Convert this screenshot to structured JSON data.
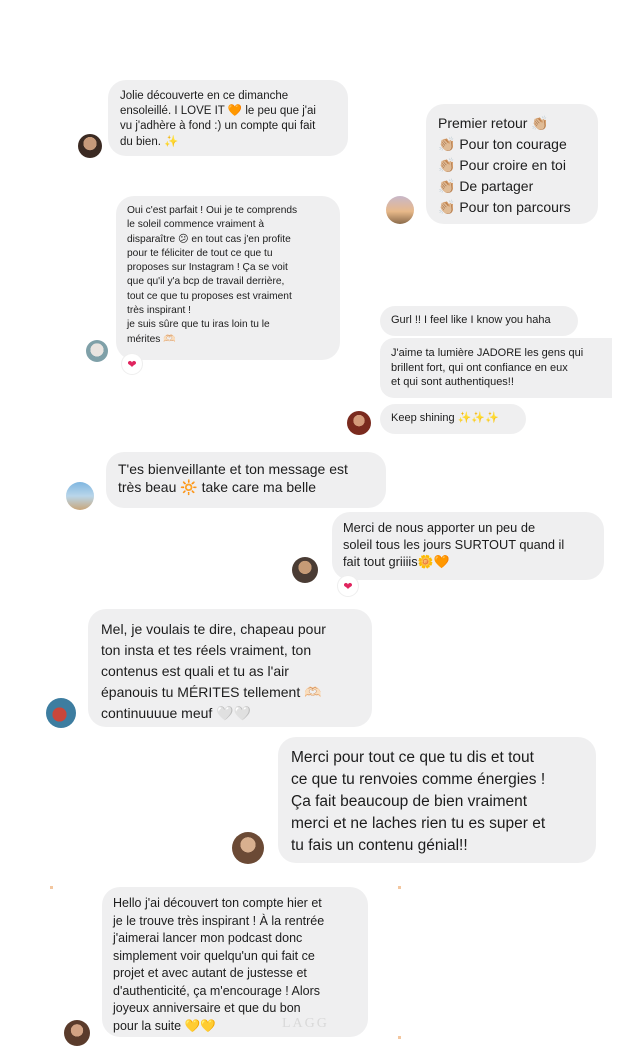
{
  "messages": [
    {
      "id": "m1",
      "lines": [
        "Jolie découverte en ce dimanche",
        "ensoleillé. I LOVE IT 🧡 le peu que j'ai",
        "vu j'adhère à fond :) un compte qui fait",
        "du bien. ✨"
      ]
    },
    {
      "id": "m2",
      "lines": [
        "Premier retour 👏🏼",
        "👏🏼 Pour ton courage",
        "👏🏼 Pour croire en toi",
        "👏🏼  De partager",
        "👏🏼 Pour ton parcours"
      ]
    },
    {
      "id": "m3",
      "lines": [
        "Oui c'est parfait ! Oui je te comprends",
        "le soleil commence vraiment à",
        "disparaître 😕 en tout cas j'en profite",
        "pour te féliciter de tout ce que tu",
        "proposes sur Instagram ! Ça se voit",
        "que qu'il y'a bcp de travail derrière,",
        "tout ce que tu proposes est vraiment",
        "très inspirant !",
        "je suis sûre que tu iras loin tu le",
        "mérites 🫶🏻"
      ],
      "reaction": "❤"
    },
    {
      "id": "m4",
      "lines": [
        "Gurl !! I feel like I know you haha"
      ]
    },
    {
      "id": "m5",
      "lines": [
        "J'aime ta lumière JADORE les gens qui",
        "brillent fort, qui ont confiance en eux",
        "et qui sont authentiques!!"
      ]
    },
    {
      "id": "m6",
      "lines": [
        "Keep shining ✨✨✨"
      ]
    },
    {
      "id": "m7",
      "lines": [
        "T'es bienveillante et ton message est",
        "très beau 🔆 take care ma belle"
      ]
    },
    {
      "id": "m8",
      "lines": [
        "Merci de nous apporter un peu de",
        "soleil tous les jours SURTOUT quand il",
        "fait tout griiiis🌼🧡"
      ],
      "reaction": "❤"
    },
    {
      "id": "m9",
      "lines": [
        "Mel, je voulais te dire, chapeau pour",
        "ton insta et tes réels vraiment, ton",
        "contenus est quali et tu as l'air",
        "épanouis tu MÉRITES tellement 🫶🏻",
        "continuuuue meuf 🤍🤍"
      ]
    },
    {
      "id": "m10",
      "lines": [
        "Merci pour tout ce que tu dis et tout",
        "ce que tu renvoies comme énergies !",
        "Ça fait beaucoup de bien vraiment",
        "merci et ne laches rien tu es super et",
        "tu fais un contenu génial!!"
      ]
    },
    {
      "id": "m11",
      "lines": [
        "Hello j'ai découvert ton compte hier et",
        "je le trouve très inspirant ! À la rentrée",
        "j'aimerai lancer mon podcast donc",
        "simplement voir quelqu'un qui fait ce",
        "projet et avec autant de justesse et",
        "d'authenticité, ça m'encourage ! Alors",
        "joyeux anniversaire et que du bon",
        "pour la suite 💛💛"
      ]
    }
  ],
  "watermark": "LAGG"
}
